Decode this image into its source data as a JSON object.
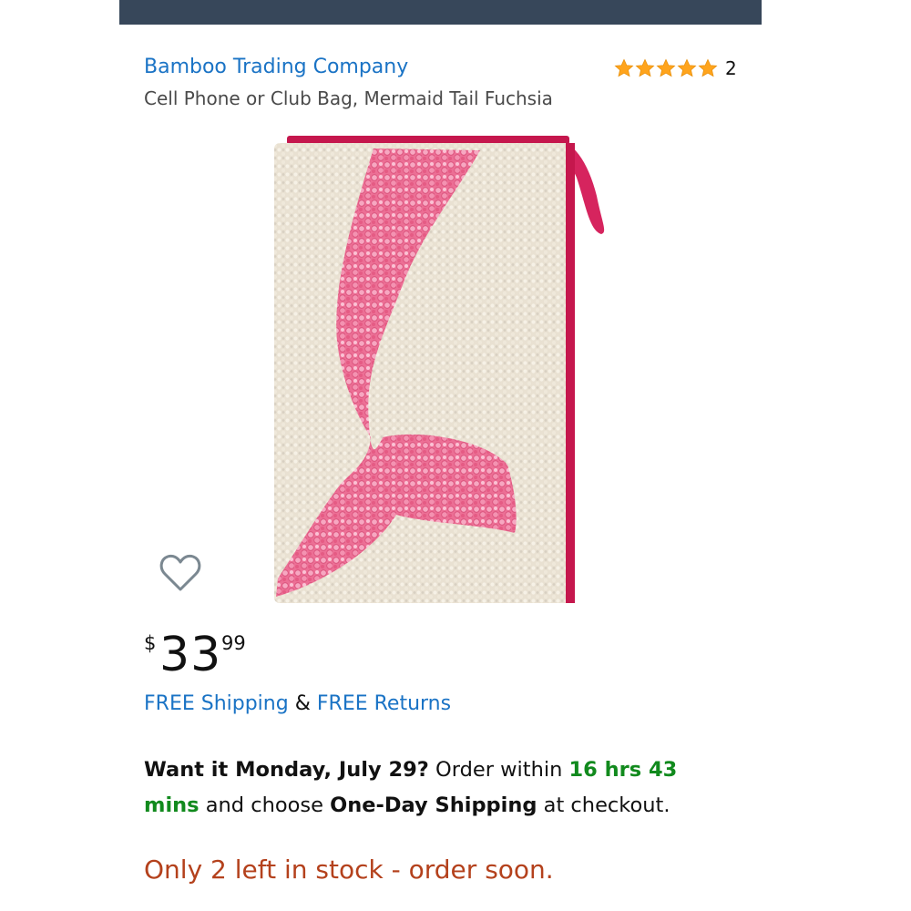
{
  "product": {
    "brand": "Bamboo Trading Company",
    "title": "Cell Phone or Club Bag, Mermaid Tail Fuchsia",
    "rating": {
      "stars": 5,
      "max_stars": 5,
      "count": "2"
    },
    "image_icon": "mermaid-tail-bag-image",
    "wishlist_icon": "heart-icon"
  },
  "price": {
    "symbol": "$",
    "whole": "33",
    "fraction": "99"
  },
  "shipping": {
    "free_shipping": "FREE Shipping",
    "ampersand": "&",
    "free_returns": "FREE Returns"
  },
  "delivery": {
    "want_it": "Want it Monday, July 29?",
    "order_within": "Order within",
    "countdown": "16 hrs 43 mins",
    "and_choose": "and choose",
    "shipping_option": "One-Day Shipping",
    "at_checkout": "at checkout."
  },
  "stock": {
    "message": "Only 2 left in stock - order soon."
  },
  "colors": {
    "link": "#1a73c5",
    "star": "#ffa41c",
    "countdown": "#118a1d",
    "stock_warning": "#b4411c",
    "topbar": "#37475a"
  }
}
